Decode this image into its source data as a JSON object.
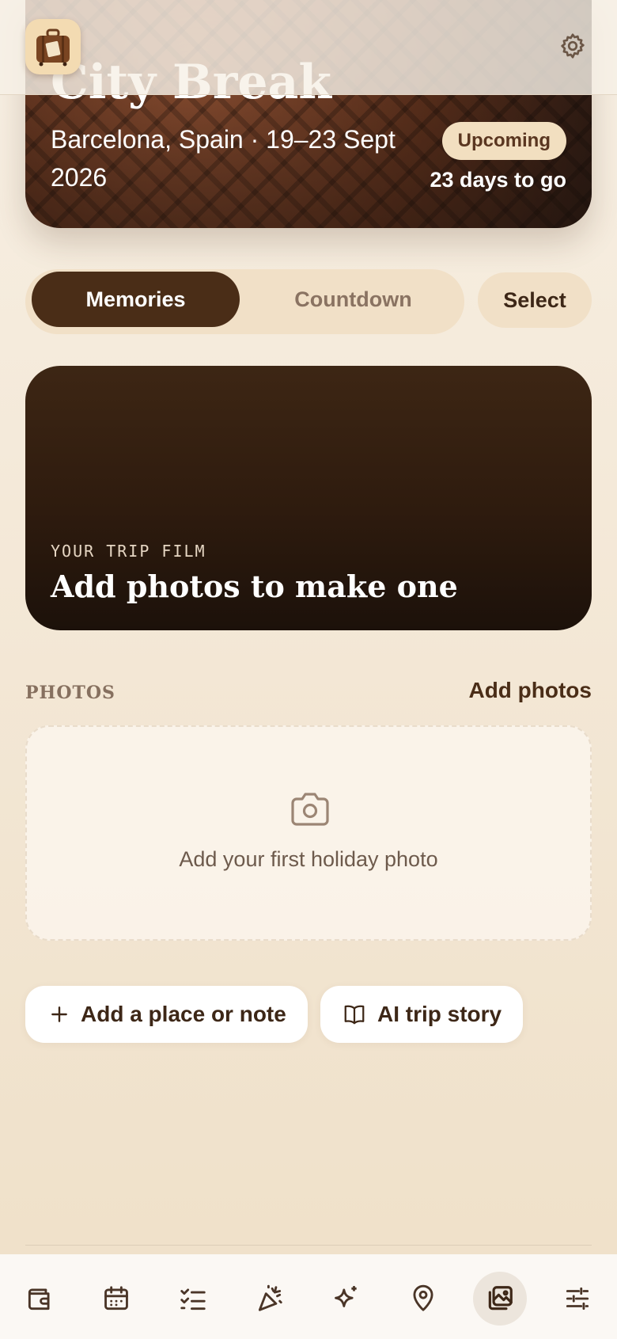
{
  "hero": {
    "title": "City Break",
    "subtitle": "Barcelona, Spain · 19–23 Sept 2026",
    "status_badge": "Upcoming",
    "countdown": "23 days to go"
  },
  "tabs": {
    "memories": "Memories",
    "countdown": "Countdown",
    "active": "Memories"
  },
  "select_label": "Select",
  "film": {
    "kicker": "YOUR TRIP FILM",
    "title": "Add photos to make one"
  },
  "photos": {
    "section_label": "PHOTOS",
    "add_label": "Add photos",
    "empty_text": "Add your first holiday photo"
  },
  "actions": {
    "add_place": "Add a place or note",
    "ai_story": "AI trip story"
  },
  "nav": {
    "items": [
      "wallet-icon",
      "calendar-icon",
      "checklist-icon",
      "party-popper-icon",
      "sparkles-icon",
      "map-pin-icon",
      "photos-icon",
      "sliders-icon"
    ],
    "active": "photos-icon"
  },
  "colors": {
    "accent_dark": "#4a2d17",
    "background": "#f5ecdf",
    "badge": "#f2dfc0"
  }
}
